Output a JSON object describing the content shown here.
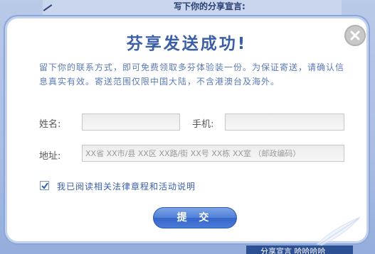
{
  "background": {
    "heading": "写下你的分享宣言:",
    "bottom_text": "分享宣言  哈哈哈哈"
  },
  "dialog": {
    "title": "芬享发送成功!",
    "close_icon": "close-icon",
    "notice": "留下你的联系方式，即可免费领取多芬体验装一份。为保证寄送，请确认信息真实有效。寄送范围仅限中国大陆，不含港澳台及海外。",
    "form": {
      "name_label": "姓名:",
      "name_value": "",
      "phone_label": "手机:",
      "phone_value": "",
      "address_label": "地址:",
      "address_placeholder": "XX省 XX市/县 XX区 XX路/街 XX号 XX栋 XX室 （邮政编码）"
    },
    "agreement": {
      "checked": true,
      "label": "我已阅读相关法律章程和活动说明"
    },
    "submit_label": "提 交"
  },
  "colors": {
    "accent": "#3a5fa8",
    "button": "#4e7fd8",
    "border": "#8aa6db"
  }
}
